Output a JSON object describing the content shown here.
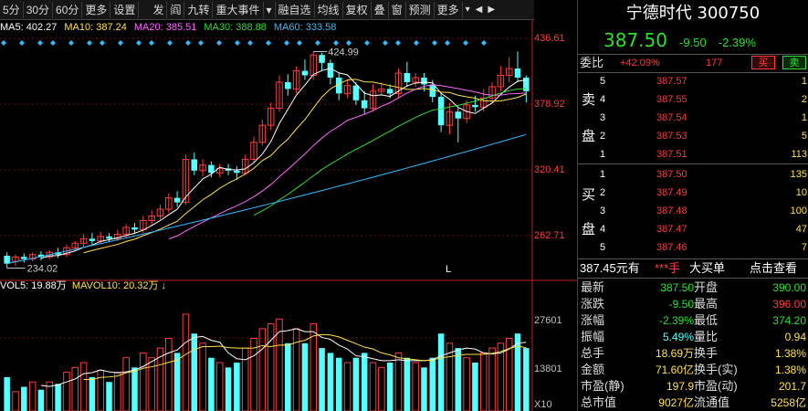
{
  "toolbar": {
    "items": [
      "5分",
      "30分",
      "60分",
      "更多",
      "设置",
      "发",
      "阎",
      "九转",
      "重大事件",
      "",
      "融自选",
      "均线",
      "复权",
      "叠",
      "窗",
      "预测",
      "更多"
    ]
  },
  "ma": {
    "ma5": "MA5: 402.27",
    "ma10": "MA10: 387.24",
    "ma20": "MA20: 385.51",
    "ma30": "MA30: 388.88",
    "ma60": "MA60: 333.58"
  },
  "axis": {
    "price_ticks": [
      "436.61",
      "378.92",
      "320.41",
      "262.71"
    ],
    "vol_ticks": [
      "27601",
      "13801",
      "X10"
    ]
  },
  "annotations": {
    "high": "424.99",
    "low": "234.02",
    "marker": "L"
  },
  "volume": {
    "vol5": "VOL5: 19.88万",
    "vol10": "MAVOL10: 20.32万"
  },
  "colors": {
    "up": "#ff3c3c",
    "down": "#54ffff",
    "bg": "#000000"
  },
  "quote": {
    "name": "宁德时代 300750",
    "price": "387.50",
    "change": "-9.50",
    "change_pct": "-2.39%",
    "weibi_label": "委比",
    "weibi_value": "+42.09%",
    "weibi_diff": "177",
    "buy_btn": "买",
    "sell_btn": "卖",
    "sell_side": [
      "卖",
      "盘"
    ],
    "buy_side": [
      "买",
      "盘"
    ],
    "asks": [
      {
        "level": "5",
        "price": "387.57",
        "vol": "1"
      },
      {
        "level": "4",
        "price": "387.55",
        "vol": "2"
      },
      {
        "level": "3",
        "price": "387.54",
        "vol": "1"
      },
      {
        "level": "2",
        "price": "387.53",
        "vol": "5"
      },
      {
        "level": "1",
        "price": "387.51",
        "vol": "113"
      }
    ],
    "bids": [
      {
        "level": "1",
        "price": "387.50",
        "vol": "135"
      },
      {
        "level": "2",
        "price": "387.49",
        "vol": "10"
      },
      {
        "level": "3",
        "price": "387.48",
        "vol": "100"
      },
      {
        "level": "4",
        "price": "387.47",
        "vol": "47"
      },
      {
        "level": "5",
        "price": "387.46",
        "vol": "7"
      }
    ],
    "info_bar": {
      "a": "387.45元有",
      "b": "***手",
      "c": "大买单",
      "d": "点击查看"
    },
    "stats": [
      {
        "k": "最新",
        "v": "387.50",
        "vc": "green",
        "k2": "开盘",
        "v2": "390.00",
        "v2c": "green"
      },
      {
        "k": "涨跌",
        "v": "-9.50",
        "vc": "green",
        "k2": "最高",
        "v2": "396.00",
        "v2c": "red"
      },
      {
        "k": "涨幅",
        "v": "-2.39%",
        "vc": "green",
        "k2": "最低",
        "v2": "374.20",
        "v2c": "green"
      },
      {
        "k": "振幅",
        "v": "5.49%",
        "vc": "cyan",
        "k2": "量比",
        "v2": "0.94",
        "v2c": "yellow"
      },
      {
        "k": "总手",
        "v": "18.69万",
        "vc": "yellow",
        "k2": "换手",
        "v2": "1.38%",
        "v2c": "yellow"
      },
      {
        "k": "金额",
        "v": "71.60亿",
        "vc": "yellow",
        "k2": "换手(实)",
        "v2": "1.38%",
        "v2c": "yellow"
      },
      {
        "k": "市盈(静)",
        "v": "197.9",
        "vc": "yellow",
        "k2": "市盈(动)",
        "v2": "201.7",
        "v2c": "yellow"
      },
      {
        "k": "总市值",
        "v": "9027亿",
        "vc": "yellow",
        "k2": "流通值",
        "v2": "5258亿",
        "v2c": "yellow"
      }
    ]
  }
}
